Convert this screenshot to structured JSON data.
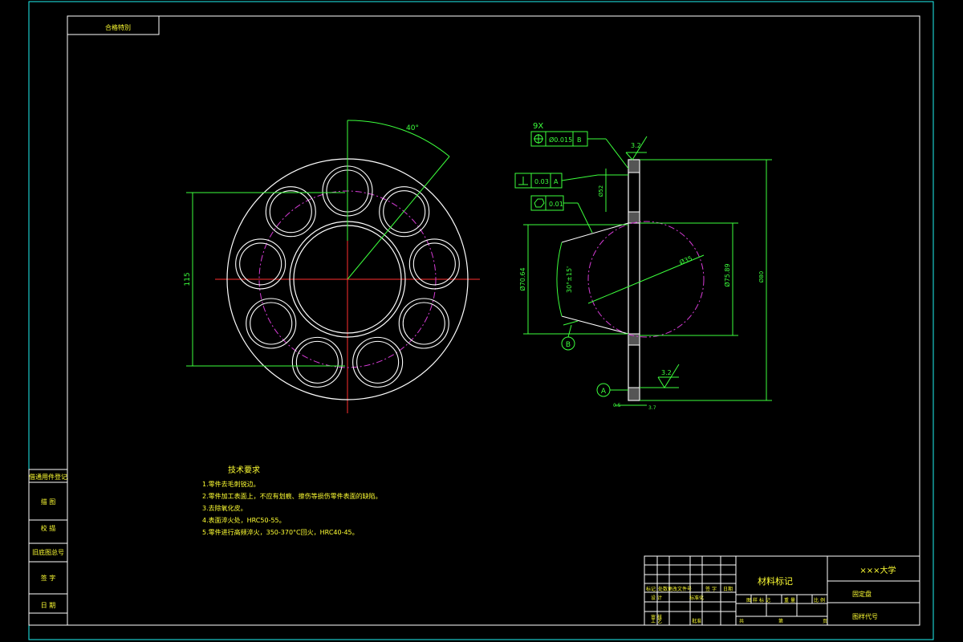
{
  "title_block": {
    "top_left_stamp": "合格特別",
    "material_label": "材料标记",
    "university": "×××大学",
    "part_name": "固定盘",
    "drawing_code_label": "图样代号",
    "header_cells": [
      "标记",
      "处数",
      "更改文件号",
      "签 字",
      "日期"
    ],
    "row_design": "设 计",
    "row_check": "审 核",
    "row_process": "工 艺",
    "std_label": "标准化",
    "approve_label": "批准",
    "stage_labels": [
      "图 样 标 记",
      "重 量",
      "比 例"
    ],
    "sheet_label": "共",
    "page_label": "第",
    "sheet_of": "页"
  },
  "left_strip": {
    "items": [
      "借通用件登记",
      "描  图",
      "校  描",
      "旧底图总号",
      "签  字",
      "日  期"
    ]
  },
  "tech_requirements": {
    "heading": "技术要求",
    "lines": [
      "1.零件去毛刺锐边。",
      "2.零件加工表面上，不应有划痕、擦伤等损伤零件表面的缺陷。",
      "3.去除氧化皮。",
      "4.表面淬火处，HRC50-55。",
      "5.零件进行高频淬火，350-370°C回火，HRC40-45。"
    ]
  },
  "front_view": {
    "angle_label": "40°",
    "dim_vertical": "115"
  },
  "side_view": {
    "repeat_label": "9X",
    "position_tol": "Ø0.015",
    "position_datum": "B",
    "perp_tol": "0.03",
    "perp_datum": "A",
    "flat_tol": "0.01",
    "rough_top": "3.2",
    "rough_bottom": "3.2",
    "dim_inner": "Ø70.64",
    "dim_angle": "30°±15'",
    "dim_circle": "Ø35",
    "dim_right": "Ø75.89",
    "dim_outer": "Ø80",
    "dim_small": "Ø52",
    "datum_a": "A",
    "datum_b": "B",
    "dim_thk_left": "0.5",
    "dim_thk_right": "3.7"
  },
  "colors": {
    "frame": "#1ff2f2",
    "white": "#ffffff",
    "red": "#ff3030",
    "magenta": "#d63cd6",
    "green": "#3cff3c",
    "yellow": "#ffff33"
  }
}
